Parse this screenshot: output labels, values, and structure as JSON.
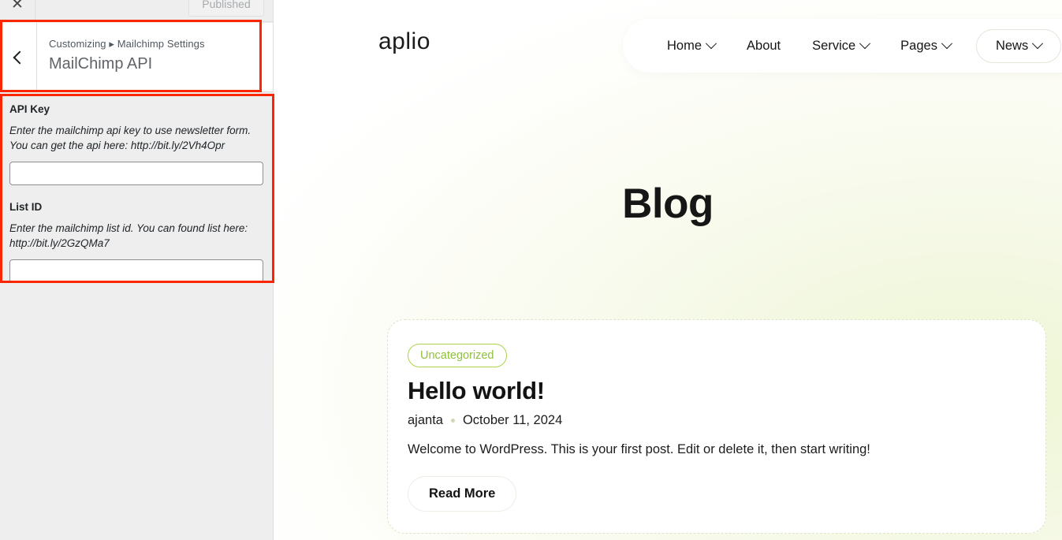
{
  "customizer": {
    "topbar": {
      "close_icon": "close-icon",
      "publish_label": "Published"
    },
    "section": {
      "back_icon": "chevron-left-icon",
      "breadcrumb_parent": "Customizing",
      "breadcrumb_separator": "▸",
      "breadcrumb_current": "Mailchimp Settings",
      "panel_title": "MailChimp API"
    },
    "controls": [
      {
        "label": "API Key",
        "description": "Enter the mailchimp api key to use newsletter form. You can get the api here: http://bit.ly/2Vh4Opr",
        "value": "",
        "placeholder": ""
      },
      {
        "label": "List ID",
        "description": "Enter the mailchimp list id. You can found list here: http://bit.ly/2GzQMa7",
        "value": "",
        "placeholder": ""
      }
    ]
  },
  "preview": {
    "brand": "aplio",
    "nav": [
      {
        "label": "Home",
        "has_caret": true,
        "boxed": false
      },
      {
        "label": "About",
        "has_caret": false,
        "boxed": false
      },
      {
        "label": "Service",
        "has_caret": true,
        "boxed": false
      },
      {
        "label": "Pages",
        "has_caret": true,
        "boxed": false
      },
      {
        "label": "News",
        "has_caret": true,
        "boxed": true
      }
    ],
    "page_title": "Blog",
    "post": {
      "category": "Uncategorized",
      "title": "Hello world!",
      "author": "ajanta",
      "date": "October 11, 2024",
      "excerpt": "Welcome to WordPress. This is your first post. Edit or delete it, then start writing!",
      "read_more_label": "Read More"
    }
  },
  "colors": {
    "accent_green": "#8fc03a",
    "badge_border": "#a9d44b",
    "annotation_red": "#fa2600",
    "sidebar_bg": "#eeeeee"
  }
}
